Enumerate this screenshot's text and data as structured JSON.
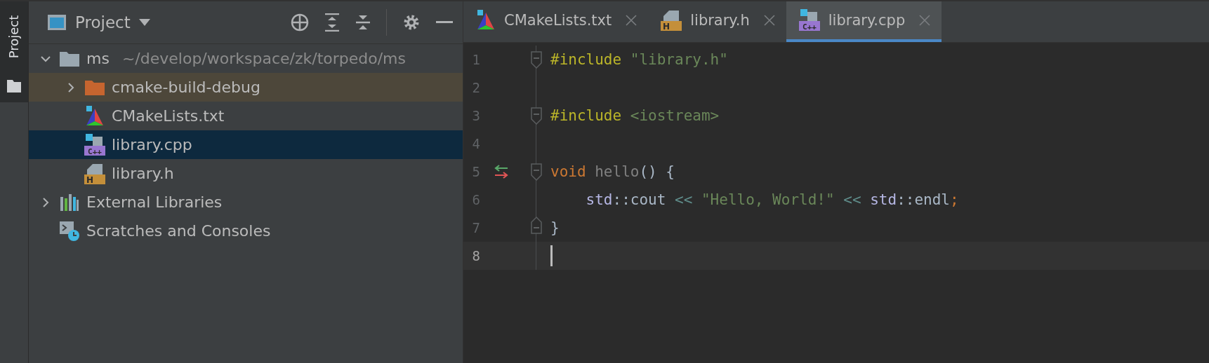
{
  "side_strip": {
    "tabs": [
      {
        "label": "Project",
        "selected": true
      }
    ]
  },
  "project_panel": {
    "title": "Project",
    "toolbar": [
      {
        "kind": "locate"
      },
      {
        "kind": "expand"
      },
      {
        "kind": "collapse"
      },
      {
        "kind": "divider"
      },
      {
        "kind": "settings"
      },
      {
        "kind": "hide"
      }
    ],
    "tree": [
      {
        "label": "ms",
        "path": "~/develop/workspace/zk/torpedo/ms",
        "kind": "folder",
        "expanded": true,
        "selected": false,
        "excluded": false,
        "children": [
          {
            "label": "cmake-build-debug",
            "kind": "excluded-folder",
            "expanded": false,
            "selected": false,
            "excluded": true
          },
          {
            "label": "CMakeLists.txt",
            "kind": "cmake",
            "selected": false,
            "excluded": false
          },
          {
            "label": "library.cpp",
            "kind": "cpp",
            "badge": "C++",
            "selected": true,
            "excluded": false
          },
          {
            "label": "library.h",
            "kind": "header",
            "badge": "H",
            "selected": false,
            "excluded": false
          }
        ]
      },
      {
        "label": "External Libraries",
        "kind": "libraries",
        "expanded": false,
        "selected": false,
        "excluded": false
      },
      {
        "label": "Scratches and Consoles",
        "kind": "scratches",
        "selected": false,
        "excluded": false
      }
    ]
  },
  "editor": {
    "tabs": [
      {
        "label": "CMakeLists.txt",
        "kind": "cmake",
        "selected": false
      },
      {
        "label": "library.h",
        "kind": "header",
        "badge": "H",
        "selected": false
      },
      {
        "label": "library.cpp",
        "kind": "cpp",
        "badge": "C++",
        "selected": true
      }
    ],
    "lines": [
      {
        "number": "1",
        "fold_start": true,
        "fold_end": false,
        "change_marker": false,
        "current": false,
        "tokens": [
          {
            "kind": "directive",
            "text": "#include "
          },
          {
            "kind": "string",
            "text": "\"library.h\""
          }
        ]
      },
      {
        "number": "2",
        "fold_start": false,
        "fold_end": false,
        "change_marker": false,
        "current": false
      },
      {
        "number": "3",
        "fold_start": true,
        "fold_end": false,
        "change_marker": false,
        "current": false,
        "tokens": [
          {
            "kind": "directive",
            "text": "#include "
          },
          {
            "kind": "string",
            "text": "<iostream>"
          }
        ]
      },
      {
        "number": "4",
        "fold_start": false,
        "fold_end": false,
        "change_marker": false,
        "current": false
      },
      {
        "number": "5",
        "fold_start": true,
        "fold_end": false,
        "change_marker": true,
        "current": false,
        "tokens": [
          {
            "kind": "keyword",
            "text": "void "
          },
          {
            "kind": "unused",
            "text": "hello"
          },
          {
            "kind": "punct",
            "text": "() {"
          }
        ]
      },
      {
        "number": "6",
        "fold_start": false,
        "fold_end": false,
        "change_marker": false,
        "current": false,
        "tokens": [
          {
            "kind": "namespace",
            "text": "    std"
          },
          {
            "kind": "punct",
            "text": "::cout "
          },
          {
            "kind": "operator",
            "text": "<< "
          },
          {
            "kind": "string",
            "text": "\"Hello, World!\" "
          },
          {
            "kind": "operator",
            "text": "<< "
          },
          {
            "kind": "namespace",
            "text": "std"
          },
          {
            "kind": "punct",
            "text": "::endl"
          },
          {
            "kind": "keyword",
            "text": ";"
          }
        ]
      },
      {
        "number": "7",
        "fold_start": false,
        "fold_end": true,
        "change_marker": false,
        "current": false,
        "tokens": [
          {
            "kind": "punct",
            "text": "}"
          }
        ]
      },
      {
        "number": "8",
        "fold_start": false,
        "fold_end": false,
        "change_marker": false,
        "current": true
      }
    ]
  }
}
